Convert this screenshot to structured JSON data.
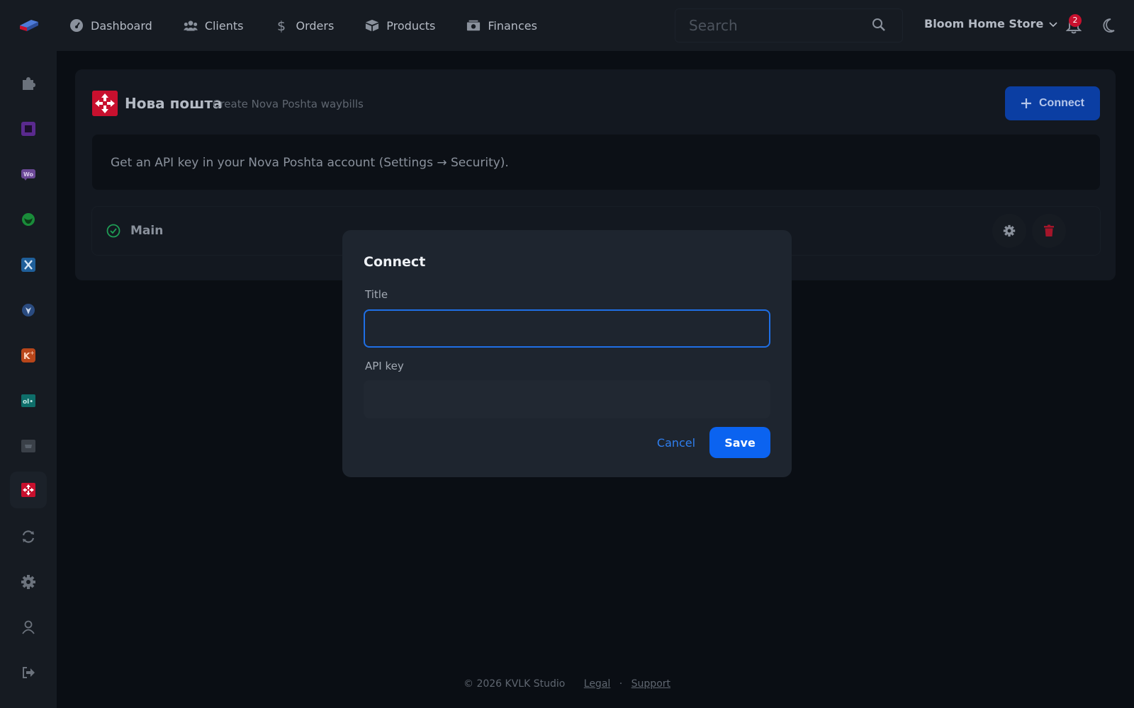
{
  "topbar": {
    "logo_icon": "app-logo-icon",
    "nav": [
      {
        "label": "Dashboard",
        "icon": "dashboard-icon"
      },
      {
        "label": "Clients",
        "icon": "users-icon"
      },
      {
        "label": "Orders",
        "icon": "dollar-icon"
      },
      {
        "label": "Products",
        "icon": "box-icon"
      },
      {
        "label": "Finances",
        "icon": "money-icon"
      }
    ],
    "search_placeholder": "Search",
    "store_name": "Bloom Home Store",
    "notifications_count": "2"
  },
  "sidebar": {
    "items": [
      {
        "icon": "puzzle-icon"
      },
      {
        "icon": "square-app-icon"
      },
      {
        "icon": "woo-icon"
      },
      {
        "icon": "green-app-icon"
      },
      {
        "icon": "x-app-icon"
      },
      {
        "icon": "shield-app-icon"
      },
      {
        "icon": "k-plus-icon"
      },
      {
        "icon": "olx-icon"
      },
      {
        "icon": "shop-icon"
      },
      {
        "icon": "nova-poshta-icon",
        "active": true
      },
      {
        "icon": "sync-icon"
      },
      {
        "icon": "gear-icon"
      },
      {
        "icon": "user-icon"
      },
      {
        "icon": "logout-icon"
      }
    ]
  },
  "integration": {
    "name": "Нова пошта",
    "subtitle": "Create Nova Poshta waybills",
    "connect_label": "Connect",
    "info_text": "Get an API key in your Nova Poshta account (Settings → Security).",
    "accounts": [
      {
        "name": "Main",
        "status": "connected"
      }
    ]
  },
  "modal": {
    "title": "Connect",
    "title_label": "Title",
    "title_value": "",
    "api_label": "API key",
    "api_value": "",
    "cancel_label": "Cancel",
    "save_label": "Save"
  },
  "footer": {
    "copyright": "© 2026 KVLK Studio",
    "legal": "Legal",
    "separator": "·",
    "support": "Support"
  },
  "colors": {
    "accent": "#0b63f0",
    "danger": "#c8102e",
    "success": "#1f9d55"
  }
}
